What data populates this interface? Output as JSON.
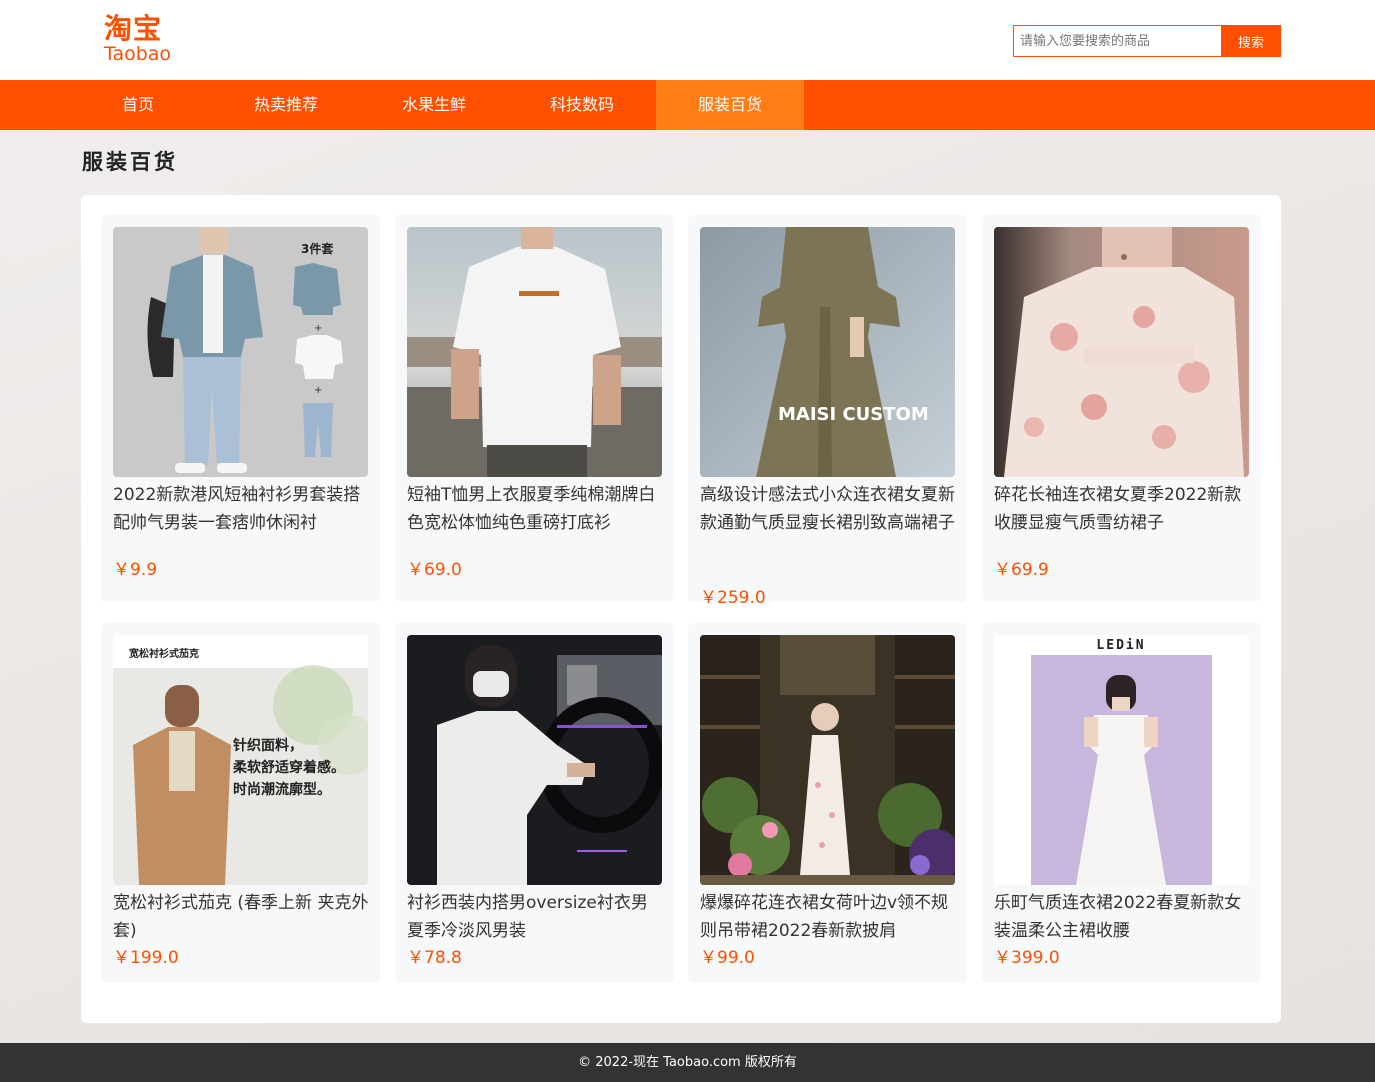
{
  "logo": {
    "cn": "淘宝",
    "en": "Taobao"
  },
  "search": {
    "placeholder": "请输入您要搜索的商品",
    "button_label": "搜索"
  },
  "nav": {
    "items": [
      {
        "label": "首页"
      },
      {
        "label": "热卖推荐"
      },
      {
        "label": "水果生鲜"
      },
      {
        "label": "科技数码"
      },
      {
        "label": "服装百货"
      }
    ],
    "active_index": 4
  },
  "section": {
    "title": "服装百货"
  },
  "products": [
    {
      "title": "2022新款港风短袖衬衫男套装搭配帅气男装一套痞帅休闲衬",
      "price": "￥9.9",
      "image_badge": "3件套"
    },
    {
      "title": "短袖T恤男上衣服夏季纯棉潮牌白色宽松体恤纯色重磅打底衫",
      "price": "￥69.0"
    },
    {
      "title": "高级设计感法式小众连衣裙女夏新款通勤气质显瘦长裙别致高端裙子",
      "price": "￥259.0",
      "image_caption": "MAISI  CUSTOM"
    },
    {
      "title": "碎花长袖连衣裙女夏季2022新款收腰显瘦气质雪纺裙子",
      "price": "￥69.9"
    },
    {
      "title": "宽松衬衫式茄克 (春季上新 夹克外套)",
      "price": "￥199.0",
      "image_header": "宽松衬衫式茄克",
      "image_lines": [
        "针织面料，",
        "柔软舒适穿着感。",
        "时尚潮流廓型。"
      ]
    },
    {
      "title": "衬衫西装内搭男oversize衬衣男夏季冷淡风男装",
      "price": "￥78.8"
    },
    {
      "title": "爆爆碎花连衣裙女荷叶边v领不规则吊带裙2022春新款披肩",
      "price": "￥99.0"
    },
    {
      "title": "乐町气质连衣裙2022春夏新款女装温柔公主裙收腰",
      "price": "￥399.0",
      "image_brand": "LEDiN"
    }
  ],
  "footer": {
    "text": "© 2022-现在 Taobao.com 版权所有"
  },
  "colors": {
    "brand": "#ff5000",
    "nav_active": "#ff7d14",
    "footer_bg": "#333333"
  }
}
